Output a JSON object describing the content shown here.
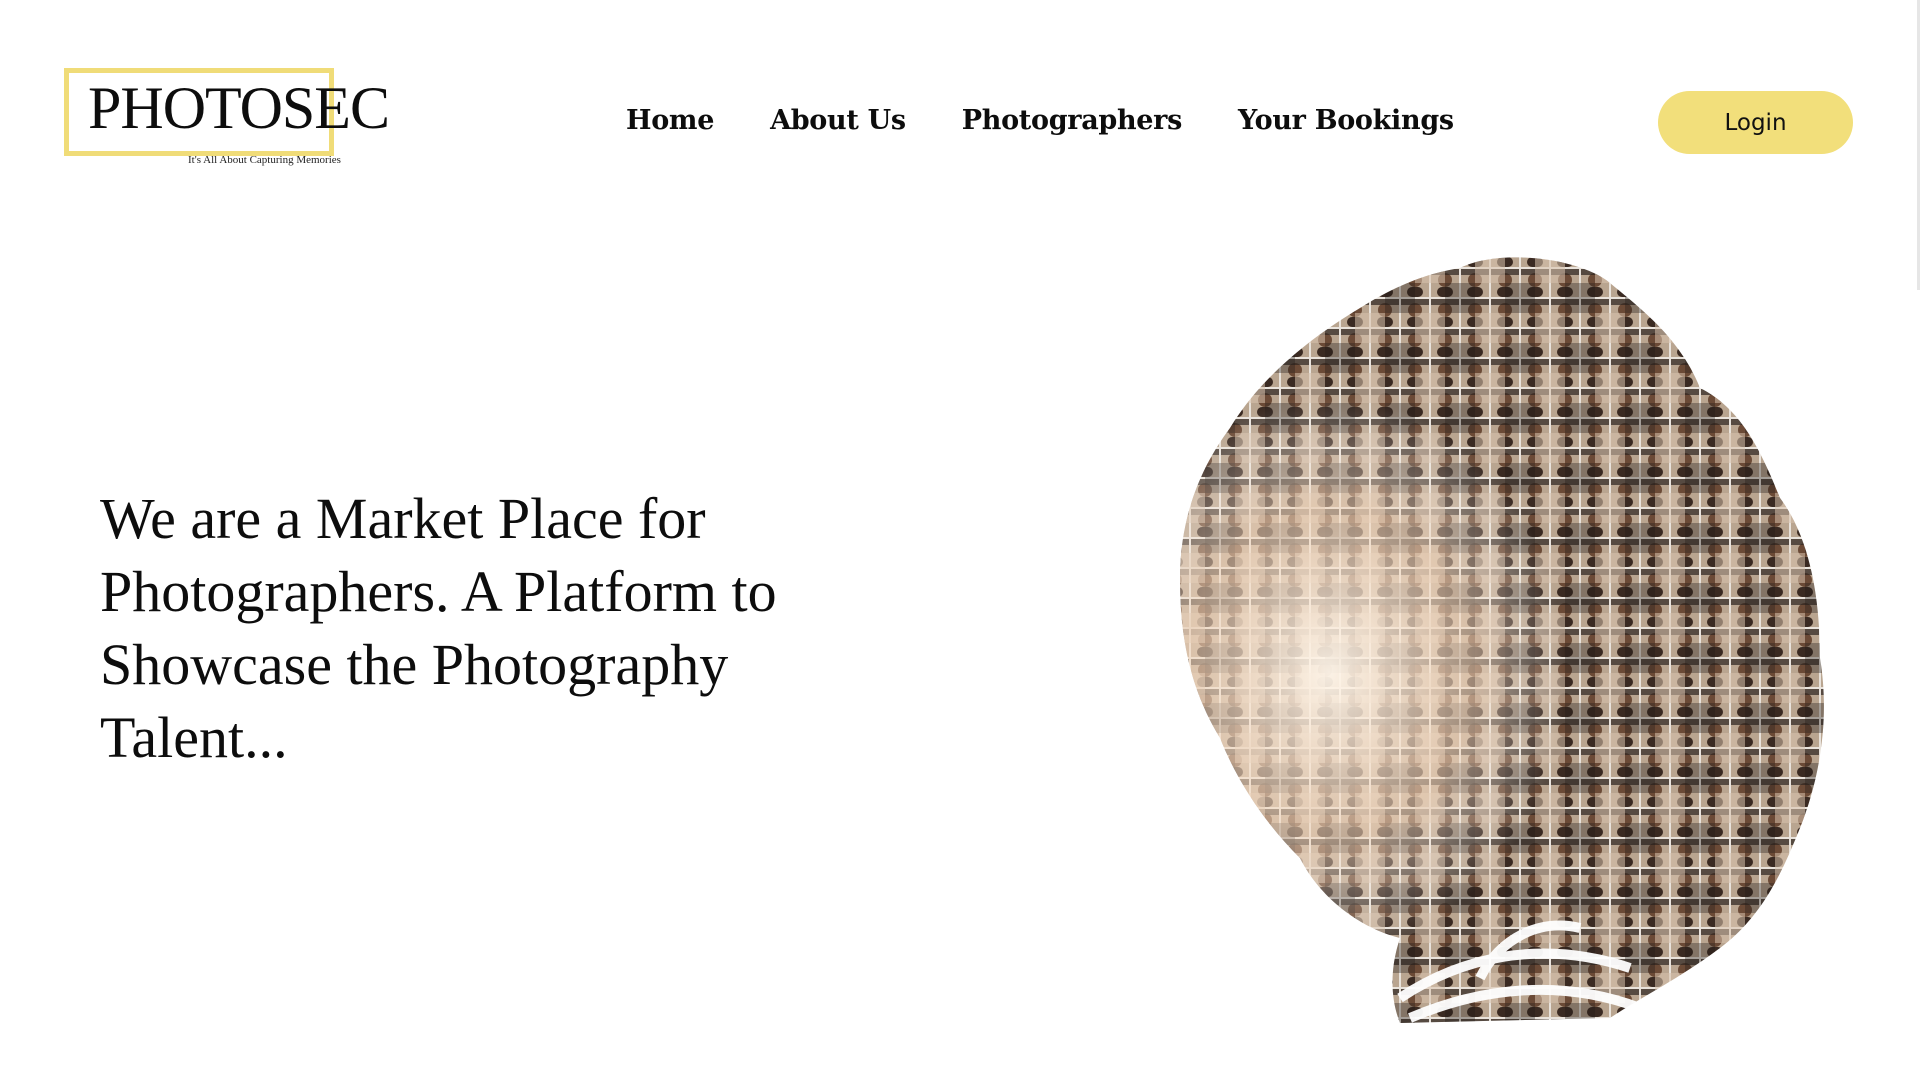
{
  "brand": {
    "name": "PHOTOSEC",
    "tagline": "It's All About Capturing Memories",
    "accent_color": "#f2df7b"
  },
  "nav": {
    "items": [
      {
        "label": "Home"
      },
      {
        "label": "About Us"
      },
      {
        "label": "Photographers"
      },
      {
        "label": "Your Bookings"
      }
    ]
  },
  "header": {
    "login_label": "Login"
  },
  "hero": {
    "heading": "We are a Market Place for Photographers. A Platform to Showcase the Photography Talent...",
    "image_icon": "face-mosaic-silhouette-illustration"
  }
}
